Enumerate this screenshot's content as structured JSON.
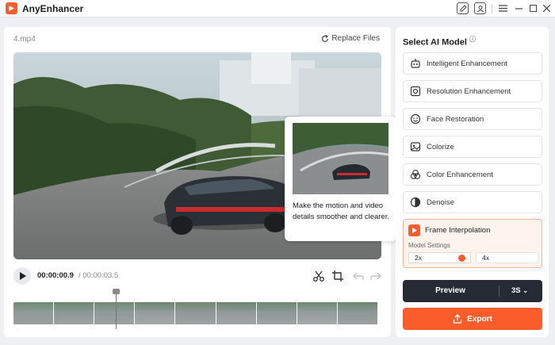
{
  "app": {
    "title": "AnyEnhancer"
  },
  "editor": {
    "file_name": "4.mp4",
    "replace_label": "Replace Files",
    "time_current": "00:00:00.9",
    "time_total": "/ 00:00:03.5",
    "tooltip_text": "Make the motion and video details smoother and clearer."
  },
  "sidebar": {
    "title": "Select AI Model",
    "models": [
      {
        "label": "Intelligent Enhancement",
        "icon": "robot-icon"
      },
      {
        "label": "Resolution Enhancement",
        "icon": "resolution-icon"
      },
      {
        "label": "Face Restoration",
        "icon": "face-icon"
      },
      {
        "label": "Colorize",
        "icon": "colorize-icon"
      },
      {
        "label": "Color Enhancement",
        "icon": "color-icon"
      },
      {
        "label": "Denoise",
        "icon": "denoise-icon"
      }
    ],
    "active_model": {
      "label": "Frame Interpolation",
      "settings_label": "Model Settings",
      "options": [
        "2x",
        "4x"
      ],
      "selected": "2x"
    },
    "preview_label": "Preview",
    "preview_seconds": "3S",
    "export_label": "Export"
  },
  "colors": {
    "accent": "#fb5c2c",
    "dark": "#252a35"
  }
}
